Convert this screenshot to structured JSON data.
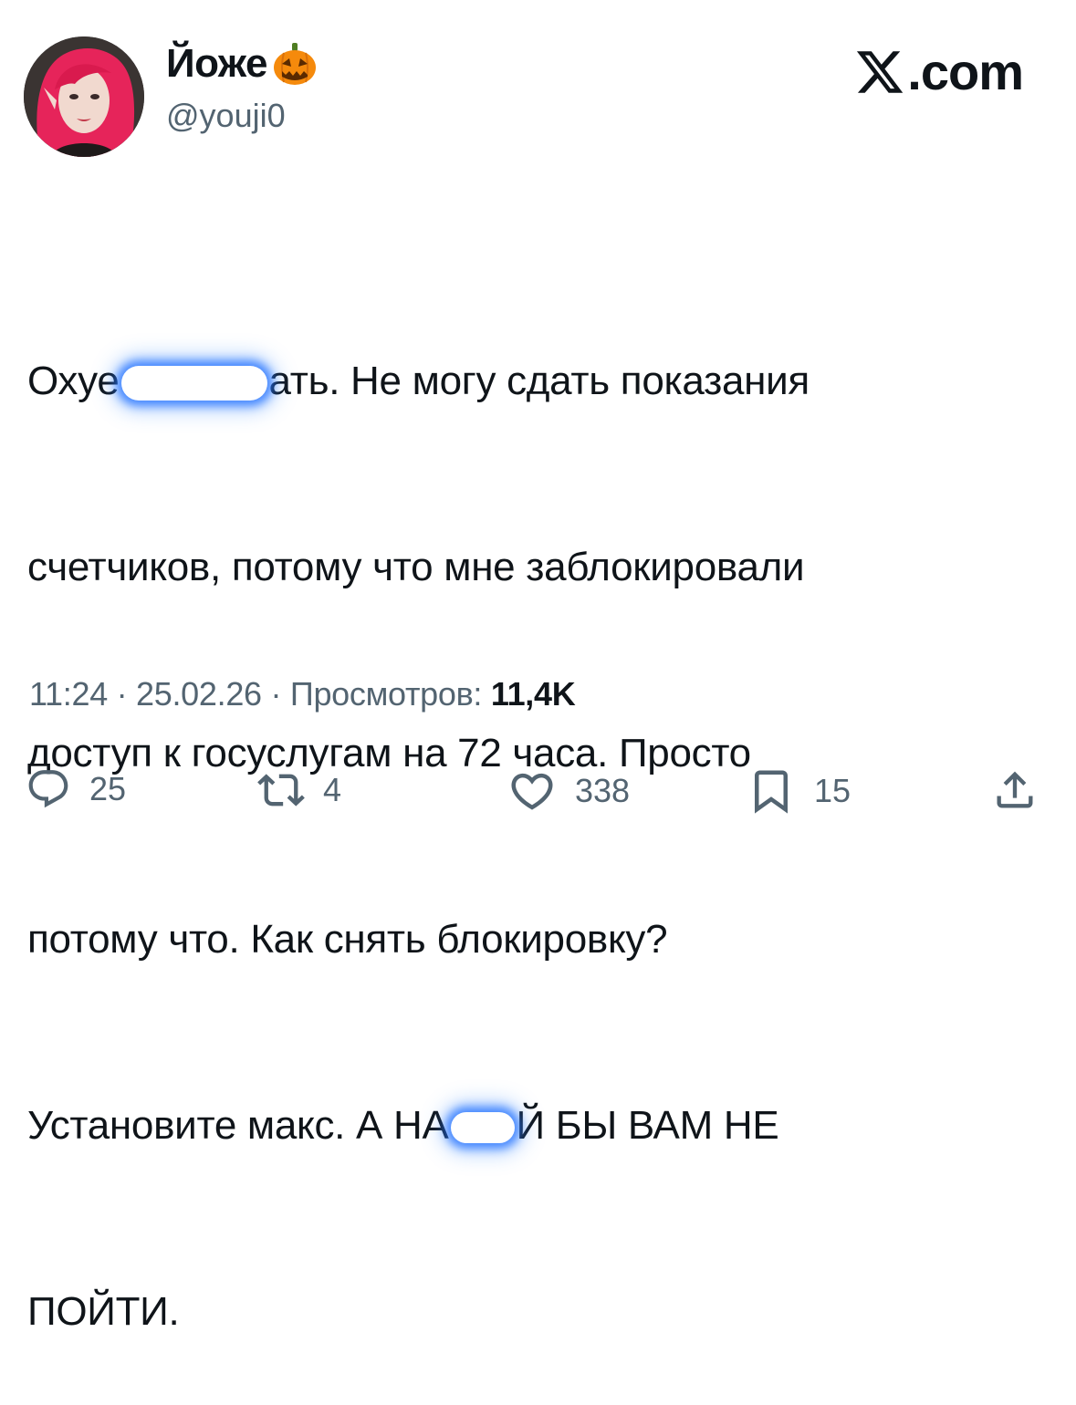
{
  "author": {
    "name": "Йоже",
    "handle": "@youji0",
    "badge_icon": "jack-o-lantern-icon"
  },
  "brand": {
    "label": ".com",
    "icon": "x-logo-icon"
  },
  "tweet": {
    "line1_a": "Охуе",
    "line1_b": "ать. Не могу сдать показания",
    "line2": "счетчиков, потому что мне заблокировали",
    "line3": "доступ к госуслугам на 72 часа. Просто",
    "line4": "потому что. Как снять блокировку?",
    "line5_a": "Установите макс. А НА",
    "line5_b": "Й БЫ ВАМ НЕ",
    "line6": "ПОЙТИ."
  },
  "meta": {
    "time": "11:24",
    "date": "25.02.26",
    "views_label": "Просмотров:",
    "views_value": "11,4K",
    "separator": "·"
  },
  "actions": {
    "replies": "25",
    "reposts": "4",
    "likes": "338",
    "bookmarks": "15"
  },
  "colors": {
    "text": "#0f1419",
    "secondary": "#536471",
    "censor_glow": "#1e6eff",
    "hair": "#e8285a"
  }
}
